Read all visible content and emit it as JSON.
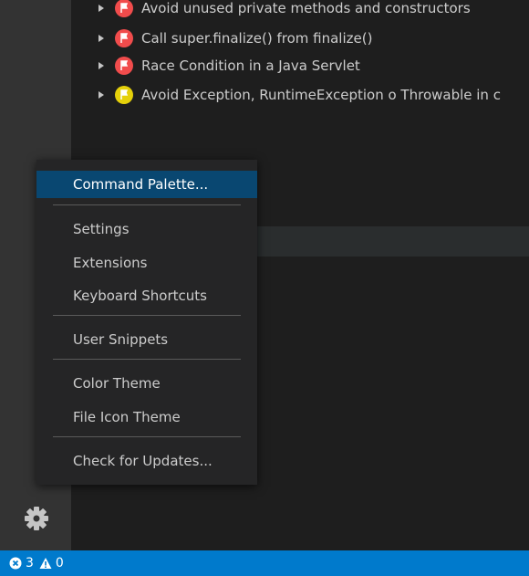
{
  "problems": [
    {
      "label": "Avoid unused private methods and constructors",
      "severity": "error"
    },
    {
      "label": "Call super.finalize() from finalize()",
      "severity": "error"
    },
    {
      "label": "Race Condition in a Java Servlet",
      "severity": "error"
    },
    {
      "label": "Avoid Exception, RuntimeException o Throwable in c",
      "severity": "warning"
    }
  ],
  "menu": {
    "command_palette": "Command Palette...",
    "settings": "Settings",
    "extensions": "Extensions",
    "keyboard_shortcuts": "Keyboard Shortcuts",
    "user_snippets": "User Snippets",
    "color_theme": "Color Theme",
    "file_icon_theme": "File Icon Theme",
    "check_updates": "Check for Updates..."
  },
  "status": {
    "errors": "3",
    "warnings": "0"
  },
  "colors": {
    "error": "#f14c4c",
    "warning": "#e5d00a",
    "accent": "#007acc",
    "menu_active": "#094771"
  }
}
